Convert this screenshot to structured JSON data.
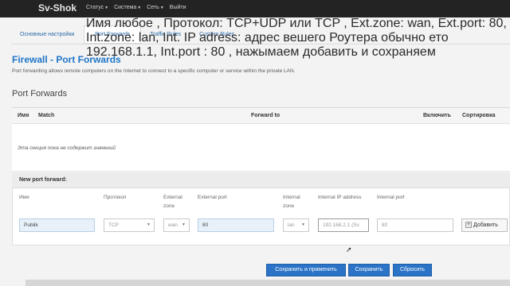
{
  "topbar": {
    "brand": "Sv-Shok",
    "nav": [
      {
        "label": "Статус"
      },
      {
        "label": "Система"
      },
      {
        "label": "Сеть"
      },
      {
        "label": "Выйти"
      }
    ]
  },
  "tabs": [
    {
      "label": "Основные настройки"
    },
    {
      "label": "Port Forwards"
    },
    {
      "label": "Traffic Rules"
    },
    {
      "label": "Custom Rules"
    }
  ],
  "caption": "Имя любое , Протокол: TCP+UDP или TCP , Ext.zone: wan, Ext.port: 80, Int.zone: lan, Int. IP adress: адрес вешего Роутера обычно ето 192.168.1.1, Int.port : 80 , нажымаем добавить и сохраняем",
  "page": {
    "title": "Firewall - Port Forwards",
    "description": "Port forwarding allows remote computers on the Internet to connect to a specific computer or service within the private LAN."
  },
  "port_forwards": {
    "section_title": "Port Forwards",
    "columns": {
      "name": "Имя",
      "match": "Match",
      "forward_to": "Forward to",
      "enable": "Включить",
      "sort": "Сортировка"
    },
    "empty_text": "Эта секция пока не содержит значений"
  },
  "new_forward": {
    "title": "New port forward:",
    "labels": {
      "name": "Имя",
      "protocol": "Протокол",
      "ext_zone": "External zone",
      "ext_port": "External port",
      "int_zone": "Internal zone",
      "int_ip": "Internal IP address",
      "int_port": "Internal port"
    },
    "values": {
      "name": "Publik",
      "protocol": "TCP",
      "ext_zone": "wan",
      "ext_port": "80",
      "int_zone": "lan",
      "int_ip": "192.168.2.1 (Sv",
      "int_port": "80"
    },
    "add_label": "Добавить"
  },
  "actions": {
    "save_apply": "Сохранить и применить",
    "save": "Сохранить",
    "reset": "Сбросить"
  }
}
